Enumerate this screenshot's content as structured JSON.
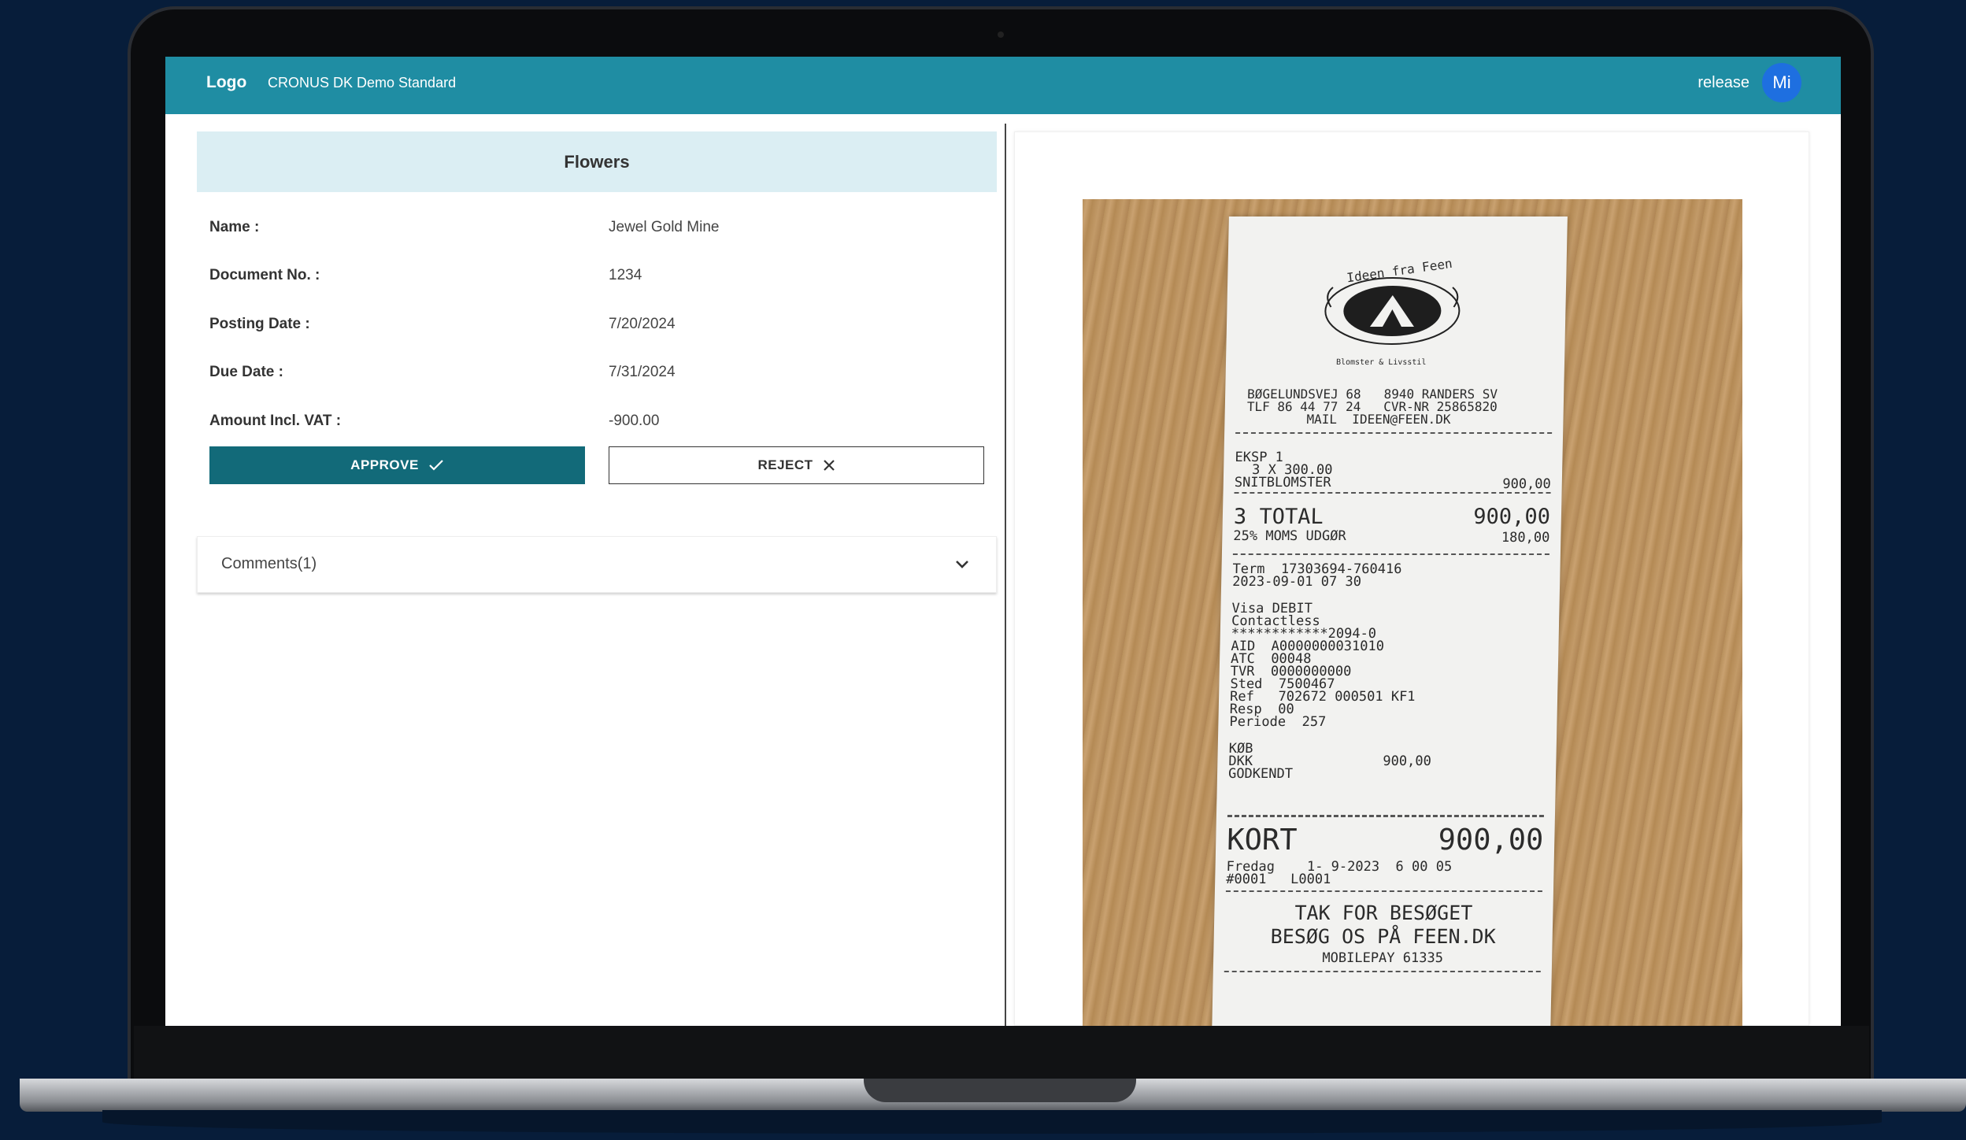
{
  "header": {
    "logo": "Logo",
    "company": "CRONUS DK Demo Standard",
    "env": "release",
    "avatar_initials": "Mi"
  },
  "document": {
    "title": "Flowers",
    "fields": [
      {
        "label": "Name :",
        "value": "Jewel Gold Mine"
      },
      {
        "label": "Document No. :",
        "value": "1234"
      },
      {
        "label": "Posting Date :",
        "value": "7/20/2024"
      },
      {
        "label": "Due Date :",
        "value": "7/31/2024"
      },
      {
        "label": "Amount Incl. VAT :",
        "value": "-900.00"
      }
    ]
  },
  "actions": {
    "approve_label": "APPROVE",
    "approve_icon": "check-icon",
    "reject_label": "REJECT",
    "reject_icon": "close-icon"
  },
  "comments": {
    "label": "Comments(1)",
    "icon": "chevron-down-icon"
  },
  "receipt": {
    "shop_logo_text": "Ideen fra Feen",
    "shop_logo_subtext": "Blomster & Livsstil",
    "address_1": "BØGELUNDSVEJ 68   8940 RANDERS SV",
    "address_2": "TLF 86 44 77 24   CVR-NR 25865820",
    "address_3": "MAIL  IDEEN@FEEN.DK",
    "eksp": "EKSP 1",
    "qty_line": "3 X 300.00",
    "item": "SNITBLOMSTER",
    "item_amount": "900,00",
    "total_label": "3 TOTAL",
    "total_amount": "900,00",
    "vat_label": "25% MOMS UDGØR",
    "vat_amount": "180,00",
    "term": "Term  17303694-760416",
    "datetime": "2023-09-01 07 30",
    "card_type": "Visa DEBIT",
    "contactless": "Contactless",
    "card_number": "************2094-0",
    "aid": "AID  A0000000031010",
    "atc": "ATC  00048",
    "tvr": "TVR  0000000000",
    "sted": "Sted  7500467",
    "ref": "Ref   702672 000501 KF1",
    "resp": "Resp  00",
    "periode": "Periode  257",
    "kob": "KØB",
    "dkk": "DKK",
    "dkk_amount": "900,00",
    "godkendt": "GODKENDT",
    "kort_label": "KORT",
    "kort_amount": "900,00",
    "footer_date": "Fredag    1- 9-2023  6 00 05",
    "footer_id": "#0001   L0001",
    "thanks_1": "TAK FOR BESØGET",
    "thanks_2": "BESØG OS PÅ FEEN.DK",
    "mobilepay": "MOBILEPAY 61335"
  }
}
